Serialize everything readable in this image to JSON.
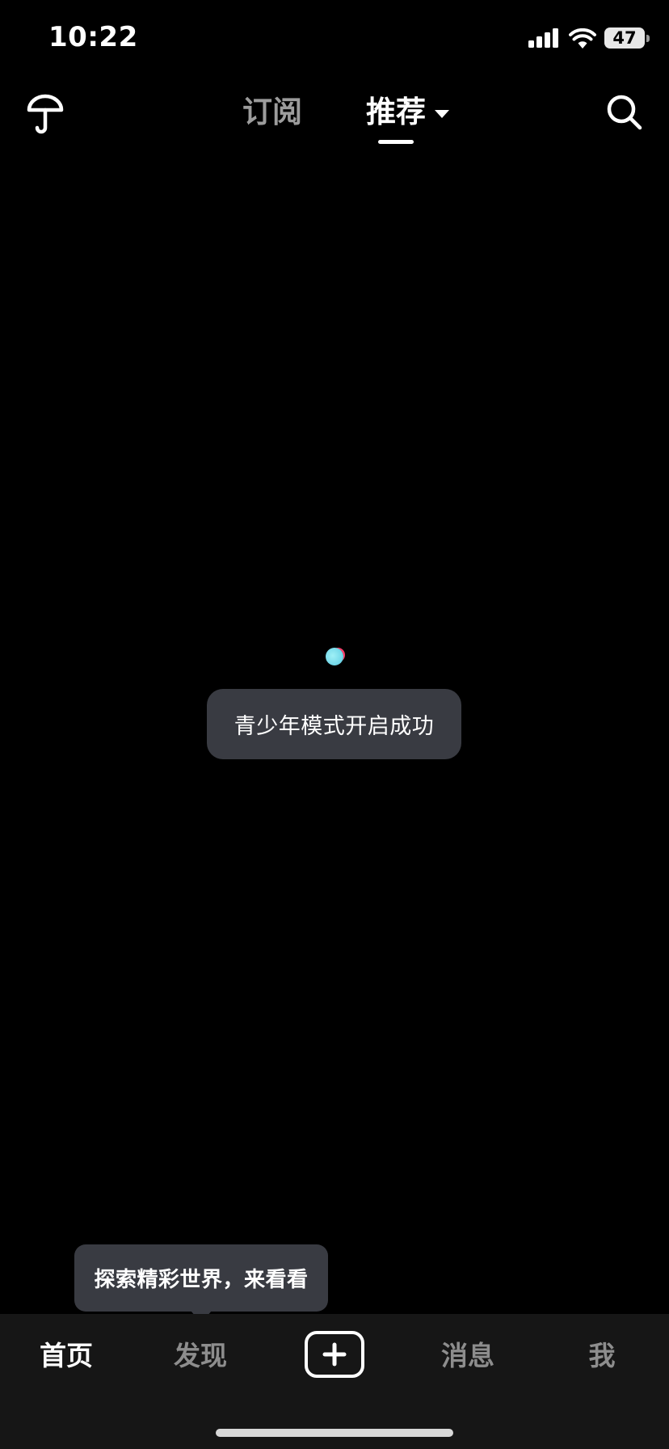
{
  "status_bar": {
    "time": "10:22",
    "battery": "47",
    "signal_icon": "cellular-signal-icon",
    "wifi_icon": "wifi-icon"
  },
  "top_nav": {
    "left_icon": "umbrella-icon",
    "tabs": [
      {
        "label": "订阅",
        "active": false
      },
      {
        "label": "推荐",
        "active": true
      }
    ],
    "right_icon": "search-icon"
  },
  "toast": {
    "text": "青少年模式开启成功"
  },
  "tooltip": {
    "text": "探索精彩世界，来看看"
  },
  "bottom_bar": {
    "items": [
      {
        "label": "首页",
        "active": true
      },
      {
        "label": "发现",
        "active": false
      },
      {
        "label": "",
        "icon": "plus-icon"
      },
      {
        "label": "消息",
        "active": false
      },
      {
        "label": "我",
        "active": false
      }
    ]
  },
  "colors": {
    "background": "#000000",
    "toast_bg": "#393b42",
    "tab_bar_bg": "#161616",
    "inactive_text": "#8d8d8d",
    "loading_dot": "#6fd6e8"
  }
}
